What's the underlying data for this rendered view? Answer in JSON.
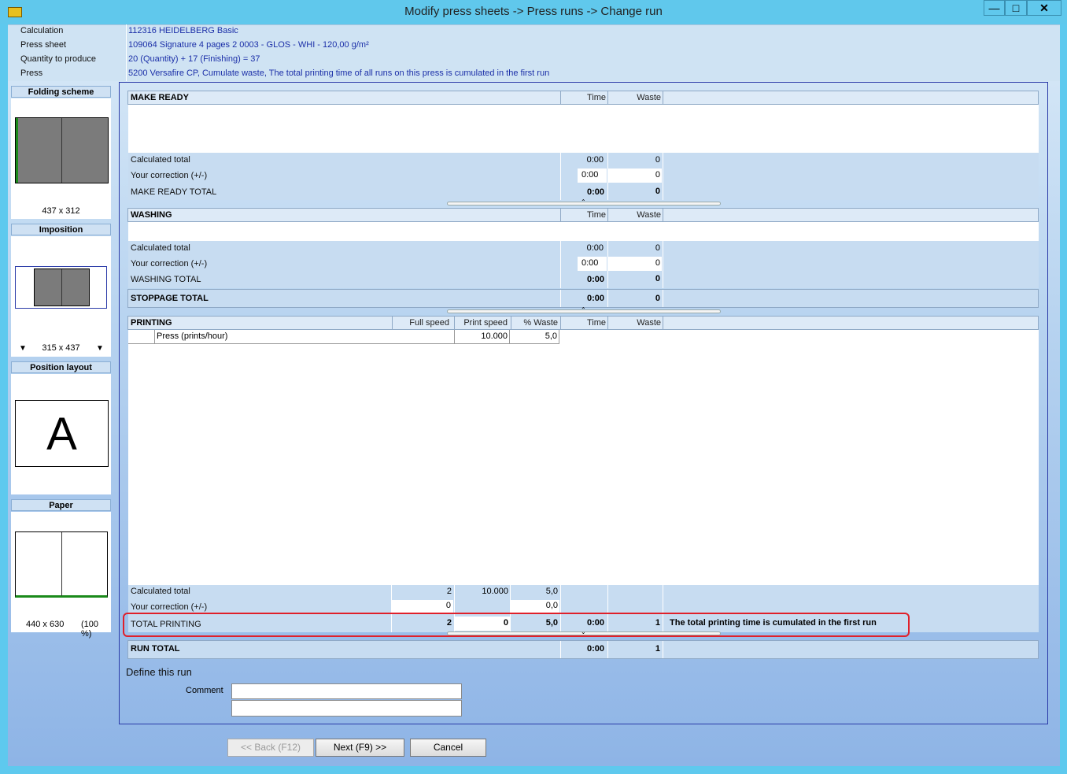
{
  "window": {
    "title": "Modify press sheets -> Press runs -> Change run",
    "min_icon": "minimize-icon",
    "max_icon": "maximize-icon",
    "close_icon": "close-icon"
  },
  "info": {
    "calculation_label": "Calculation",
    "calculation_value": "112316 HEIDELBERG Basic",
    "press_sheet_label": "Press sheet",
    "press_sheet_value": "109064 Signature 4 pages 2 0003  - GLOS - WHI - 120,00 g/m²",
    "quantity_label": "Quantity to produce",
    "quantity_value": "20 (Quantity) + 17 (Finishing) = 37",
    "press_label": "Press",
    "press_value": "5200 Versafire CP, Cumulate waste, The total printing time of all runs on this press is cumulated in the first run"
  },
  "left": {
    "folding_title": "Folding scheme",
    "folding_size": "437 x 312",
    "imposition_title": "Imposition",
    "imposition_size": "315 x 437",
    "position_title": "Position layout",
    "position_letter": "A",
    "paper_title": "Paper",
    "paper_size": "440 x 630",
    "paper_zoom": "(100 %)"
  },
  "make_ready": {
    "title": "MAKE READY",
    "col_time": "Time",
    "col_waste": "Waste",
    "calc_label": "Calculated total",
    "calc_time": "0:00",
    "calc_waste": "0",
    "corr_label": "Your correction (+/-)",
    "corr_time": "0:00",
    "corr_waste": "0",
    "total_label": "MAKE READY TOTAL",
    "total_time": "0:00",
    "total_waste": "0"
  },
  "washing": {
    "title": "WASHING",
    "col_time": "Time",
    "col_waste": "Waste",
    "calc_label": "Calculated total",
    "calc_time": "0:00",
    "calc_waste": "0",
    "corr_label": "Your correction (+/-)",
    "corr_time": "0:00",
    "corr_waste": "0",
    "total_label": "WASHING TOTAL",
    "total_time": "0:00",
    "total_waste": "0"
  },
  "stoppage": {
    "label": "STOPPAGE TOTAL",
    "time": "0:00",
    "waste": "0"
  },
  "printing": {
    "title": "PRINTING",
    "col_full_speed": "Full speed",
    "col_print_speed": "Print speed",
    "col_pct_waste": "% Waste",
    "col_time": "Time",
    "col_waste": "Waste",
    "row_label": "Press   (prints/hour)",
    "row_print_speed": "10.000",
    "row_pct_waste": "5,0",
    "calc_label": "Calculated total",
    "calc_full": "2",
    "calc_print": "10.000",
    "calc_pct": "5,0",
    "corr_label": "Your correction (+/-)",
    "corr_full": "0",
    "corr_pct": "0,0",
    "total_label": "TOTAL PRINTING",
    "total_full": "2",
    "total_print": "0",
    "total_pct": "5,0",
    "total_time": "0:00",
    "total_waste": "1",
    "total_note": "The total printing time is cumulated in the first run"
  },
  "run_total": {
    "label": "RUN TOTAL",
    "time": "0:00",
    "waste": "1"
  },
  "define": {
    "title": "Define this run",
    "comment_label": "Comment",
    "comment_value": "",
    "comment2_value": ""
  },
  "buttons": {
    "back": "<< Back (F12)",
    "next": "Next (F9) >>",
    "cancel": "Cancel"
  },
  "colors": {
    "highlight": "#e0202a",
    "value_text": "#1b2fa8"
  }
}
